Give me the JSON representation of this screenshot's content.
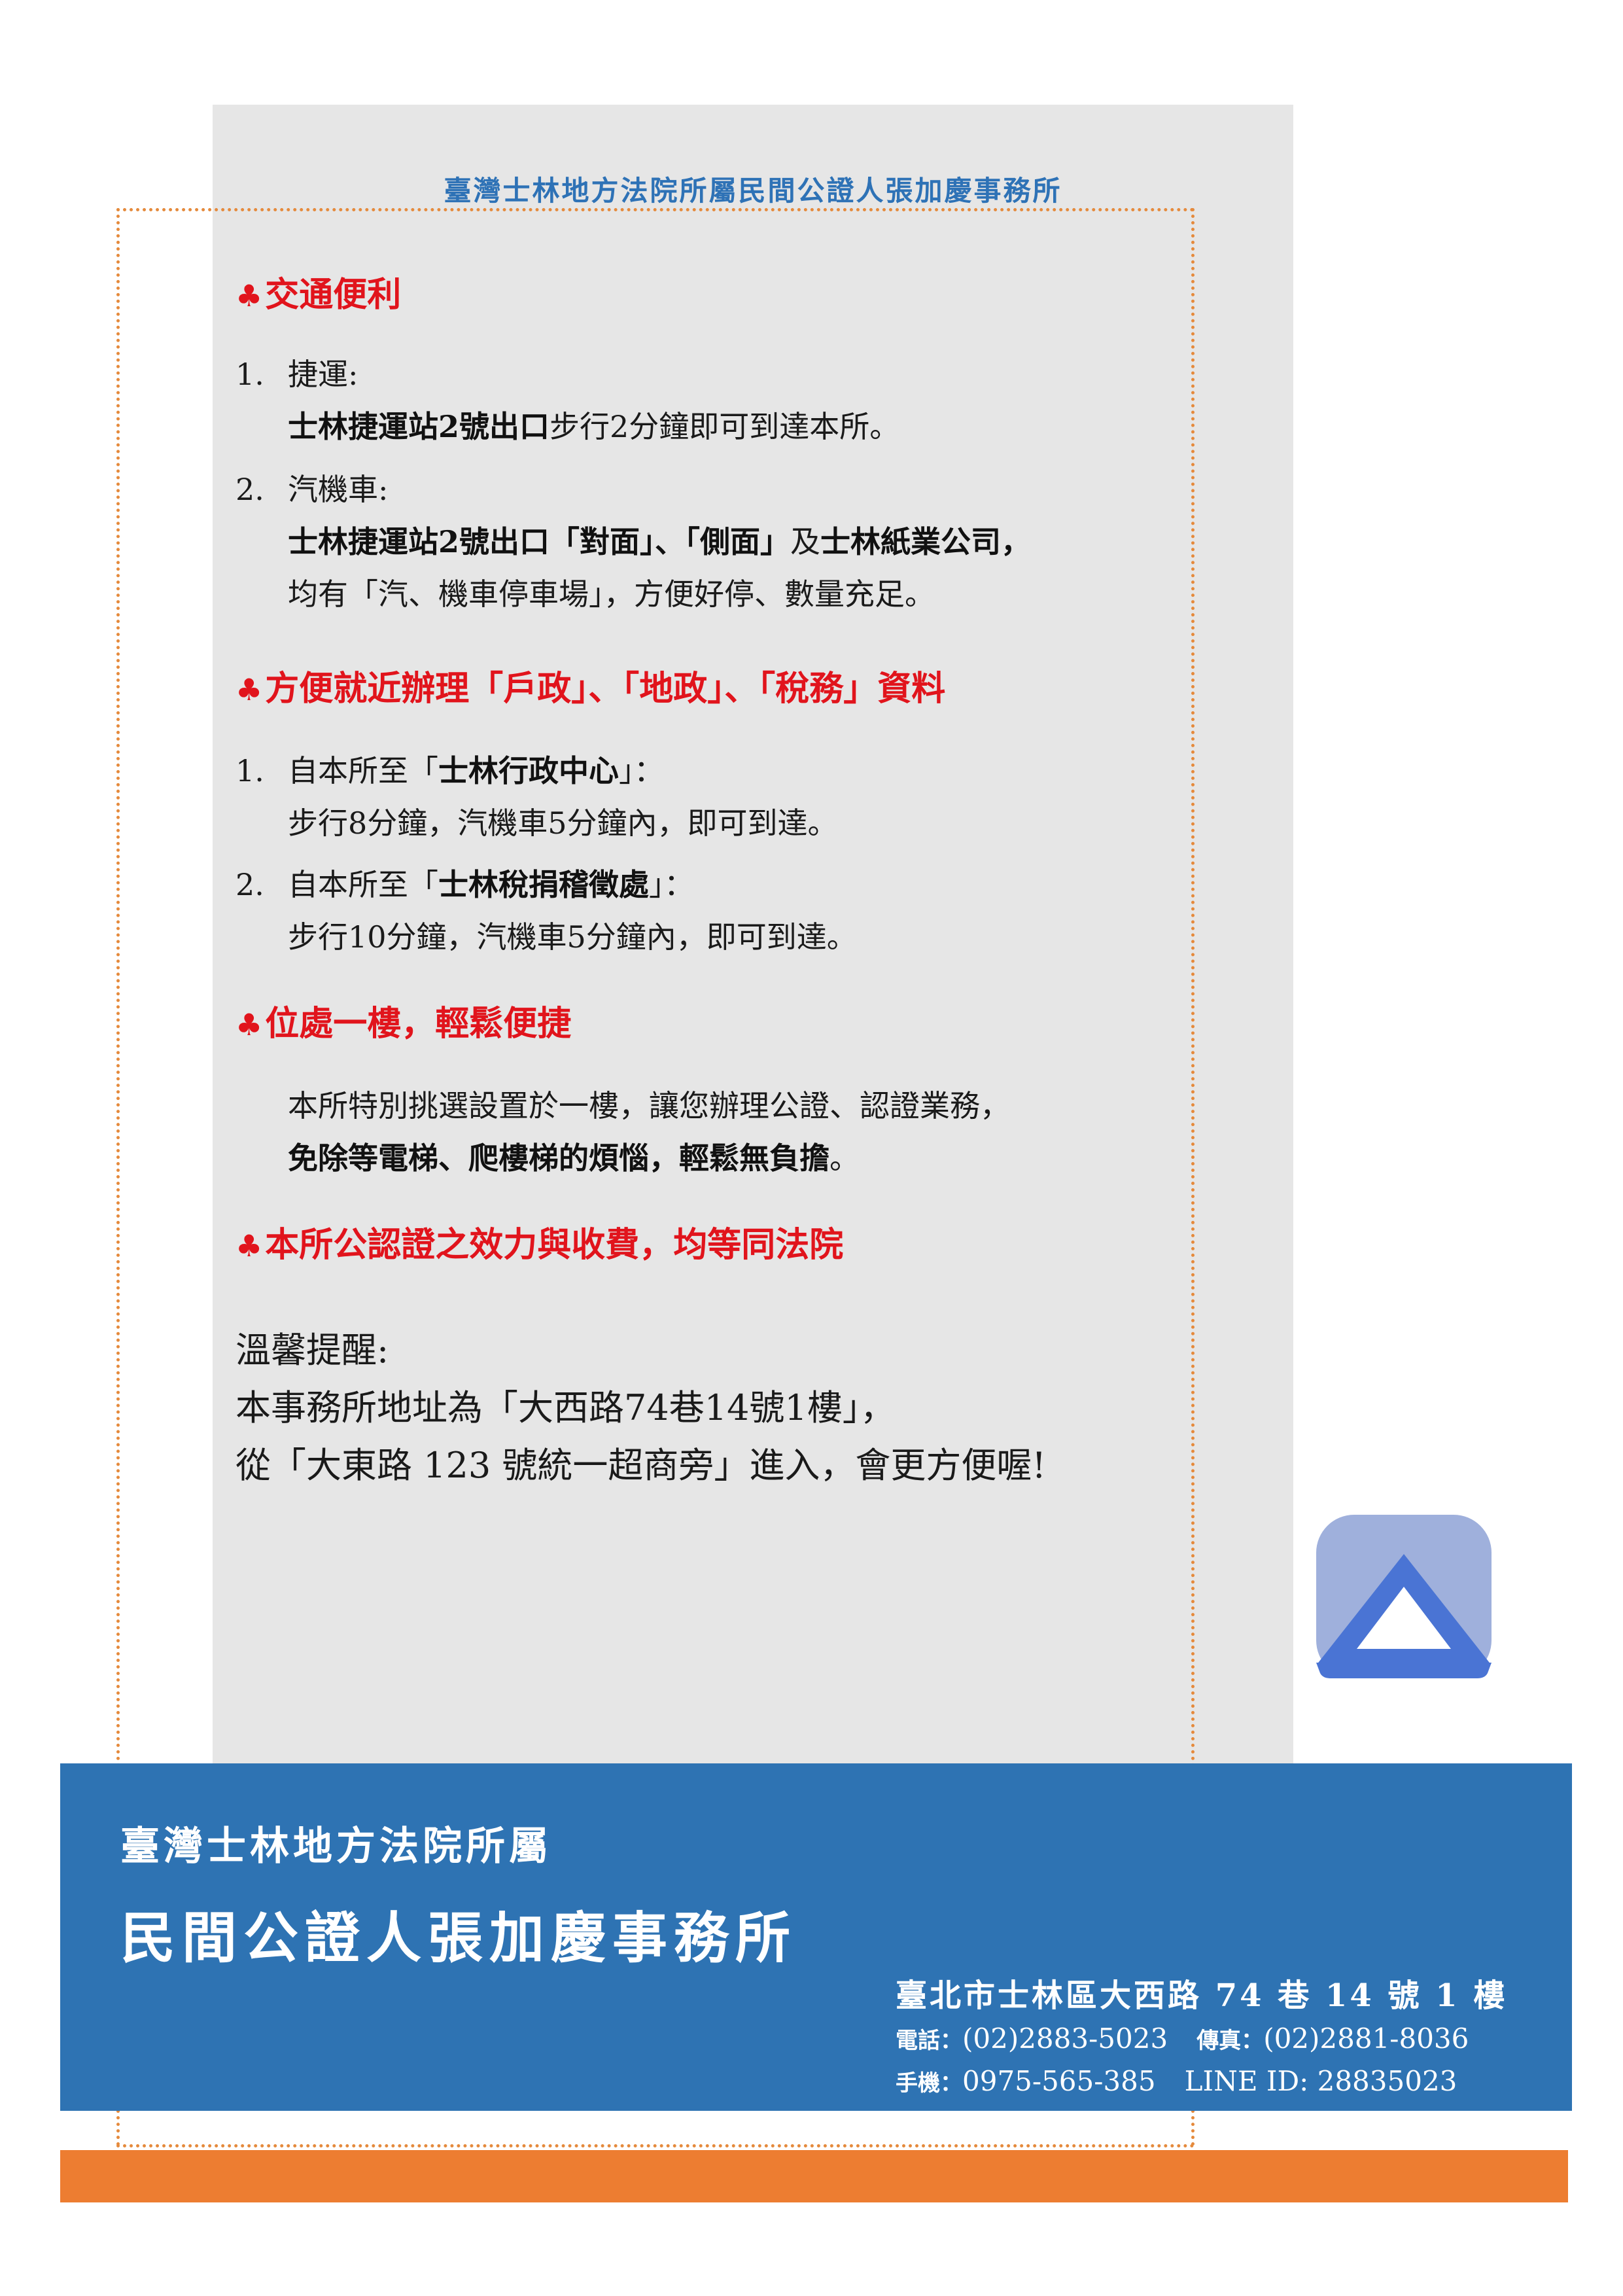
{
  "header": {
    "title": "臺灣士林地方法院所屬民間公證人張加慶事務所"
  },
  "sections": [
    {
      "id": "transport",
      "title": "交通便利",
      "items": [
        {
          "num": "1.",
          "line1": "捷運:",
          "line2_bold": "士林捷運站2號出口",
          "line2_rest": "步行2分鐘即可到達本所。"
        },
        {
          "num": "2.",
          "line1": "汽機車:",
          "line2_a": "士林捷運站2號出口「對面」、「側面」",
          "line2_b": "及",
          "line2_c": "士林紙業公司，",
          "line3": "均有「汽、機車停車場」，方便好停、數量充足。"
        }
      ]
    },
    {
      "id": "nearby",
      "title": "方便就近辦理「戶政」、「地政」、「稅務」資料",
      "items": [
        {
          "num": "1.",
          "pre": "自本所至「",
          "bold": "士林行政中心",
          "post": "」：",
          "line2": "步行8分鐘，汽機車5分鐘內，即可到達。"
        },
        {
          "num": "2.",
          "pre": "自本所至「",
          "bold": "士林稅捐稽徵處",
          "post": "」：",
          "line2": "步行10分鐘，汽機車5分鐘內，即可到達。"
        }
      ]
    },
    {
      "id": "ground-floor",
      "title": "位處一樓，輕鬆便捷",
      "line1": "本所特別挑選設置於一樓，讓您辦理公證、認證業務，",
      "line2_bold": "免除等電梯、爬樓梯的煩惱，輕鬆無負擔",
      "line2_end": "。"
    },
    {
      "id": "equal",
      "title": "本所公認證之效力與收費，均等同法院"
    }
  ],
  "club_symbol": "♣",
  "reminder": {
    "heading": "溫馨提醒:",
    "line1": "本事務所地址為「大西路74巷14號1樓」，",
    "line2": "從「大東路 123 號統一超商旁」進入，會更方便喔!"
  },
  "footer": {
    "subtitle": "臺灣士林地方法院所屬",
    "name": "民間公證人張加慶事務所",
    "address": "臺北市士林區大西路 74 巷 14 號 1 樓",
    "phone_label": "電話：",
    "phone": "(02)2883-5023",
    "fax_label": "傳真：",
    "fax": "(02)2881-8036",
    "mobile_label": "手機：",
    "mobile": "0975-565-385",
    "line_id": "LINE ID: 28835023"
  },
  "colors": {
    "accent_red": "#e1141c",
    "title_blue": "#2e72b6",
    "footer_blue": "#2e73b3",
    "orange": "#ed7d31",
    "panel_grey": "#e6e6e6",
    "logo_light": "#9fb0dc",
    "logo_dark": "#4a74d4"
  },
  "logo": {
    "icon": "triangle-logo-icon"
  }
}
